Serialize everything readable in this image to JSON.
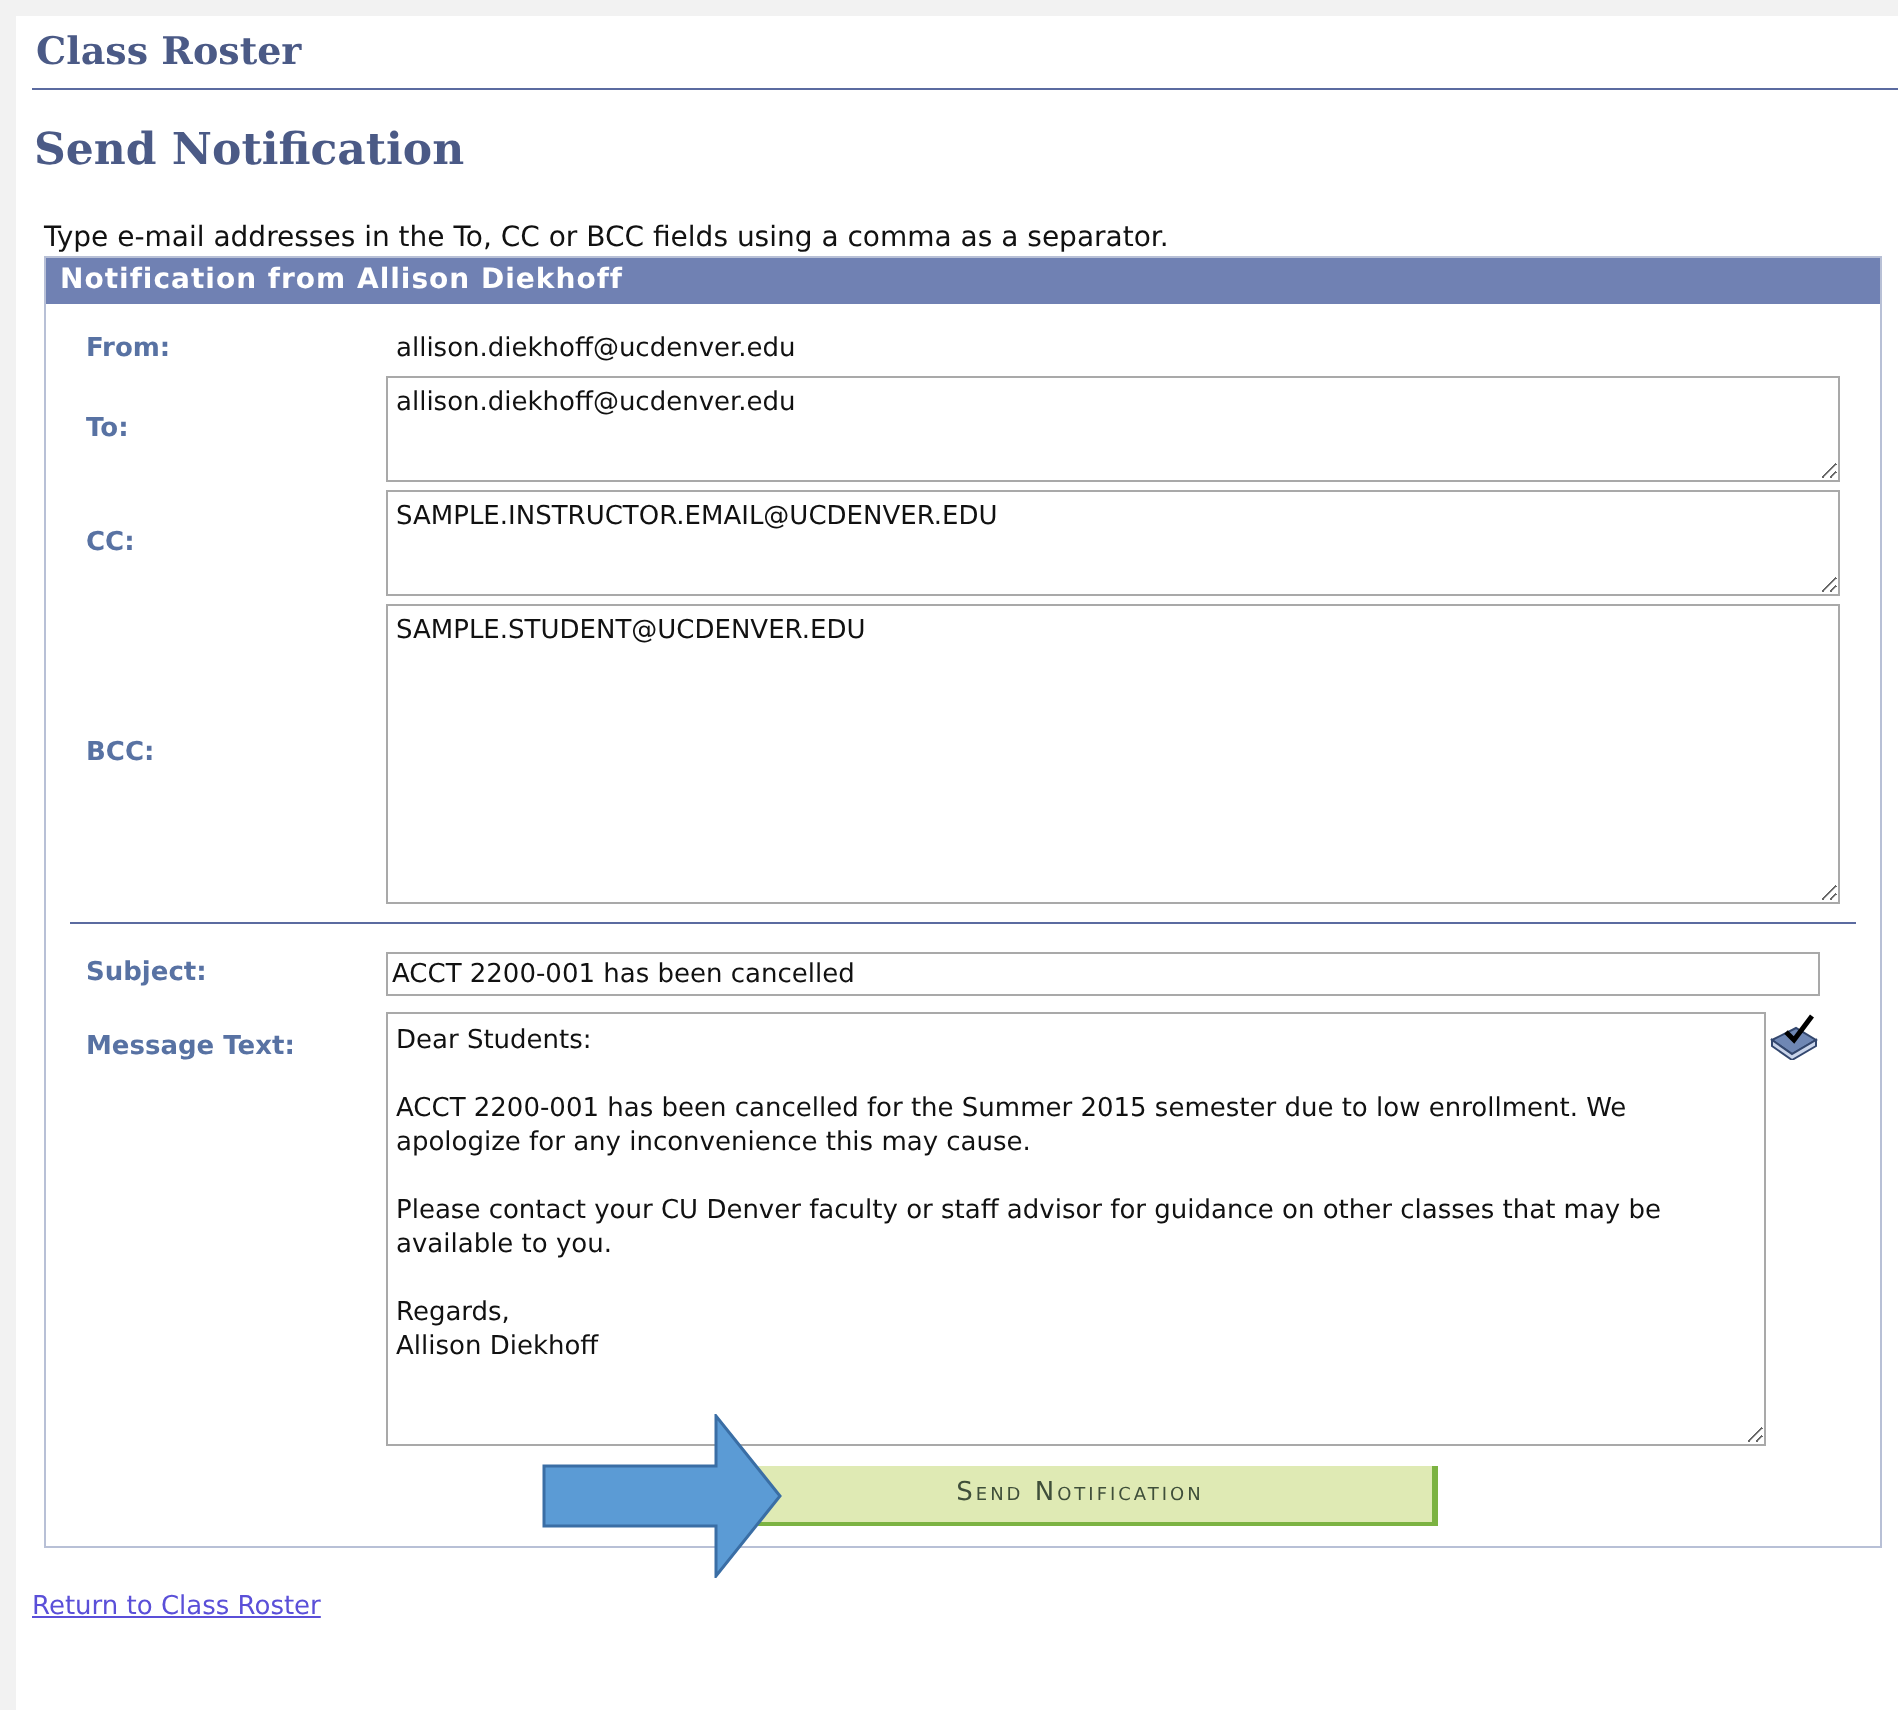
{
  "breadcrumb": "Class Roster",
  "title": "Send Notification",
  "instructions": "Type e-mail addresses in the To, CC or BCC fields using a comma as a separator.",
  "panel": {
    "header": "Notification from Allison Diekhoff",
    "from": {
      "label": "From:",
      "value": "allison.diekhoff@ucdenver.edu"
    },
    "recipients": [
      {
        "label": "To:",
        "value": "allison.diekhoff@ucdenver.edu",
        "kind": "short"
      },
      {
        "label": "CC:",
        "value": "SAMPLE.INSTRUCTOR.EMAIL@UCDENVER.EDU",
        "kind": "short"
      },
      {
        "label": "BCC:",
        "value": "SAMPLE.STUDENT@UCDENVER.EDU",
        "kind": "tall"
      }
    ],
    "subject": {
      "label": "Subject:",
      "value": "ACCT 2200-001 has been cancelled"
    },
    "message": {
      "label": "Message Text:",
      "value": "Dear Students:\n\nACCT 2200-001 has been cancelled for the Summer 2015 semester due to low enrollment. We apologize for any inconvenience this may cause.\n\nPlease contact your CU Denver faculty or staff advisor for guidance on other classes that may be available to you.\n\nRegards,\nAllison Diekhoff"
    },
    "button": "Send Notification"
  },
  "link": "Return to Class Roster"
}
